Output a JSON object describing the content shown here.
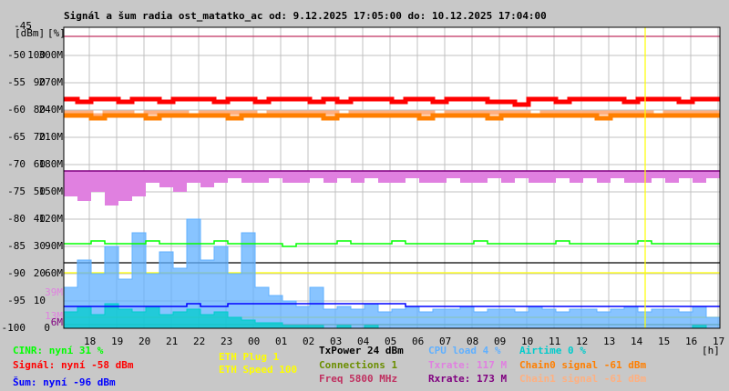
{
  "chart_data": {
    "type": "line",
    "title": "Signál a šum radia ost_matatko_ac od: 9.12.2025 17:05:00 do: 10.12.2025 17:04:00",
    "y_axis_labels": {
      "dbm_header": "[dBm]",
      "pct_header": "[%]",
      "dbm": [
        "-45",
        "-50",
        "-55",
        "-60",
        "-65",
        "-70",
        "-75",
        "-80",
        "-85",
        "-90",
        "-95",
        "-100"
      ],
      "pct": [
        "",
        "100",
        "90",
        "80",
        "70",
        "60",
        "50",
        "40",
        "30",
        "20",
        "10",
        "0"
      ],
      "rate": [
        "",
        "300M",
        "270M",
        "240M",
        "210M",
        "180M",
        "150M",
        "120M",
        "90M",
        "60M",
        "",
        ""
      ]
    },
    "ylim_dbm": [
      -100,
      -45
    ],
    "min_markers": [
      {
        "label": "39M",
        "value": 39,
        "color": "#e080e0"
      },
      {
        "label": "13M",
        "value": 13,
        "color": "#e080e0"
      },
      {
        "label": "6M",
        "value": 6,
        "color": "#800080"
      }
    ],
    "x_ticks": [
      "18",
      "19",
      "20",
      "21",
      "22",
      "23",
      "00",
      "01",
      "02",
      "03",
      "04",
      "05",
      "06",
      "07",
      "08",
      "09",
      "10",
      "11",
      "12",
      "13",
      "14",
      "15",
      "16",
      "17"
    ],
    "x_unit": "[h]",
    "x_start": "9.12.2025 17:05",
    "x_step_minutes": 30,
    "grid": true,
    "marker_time": "10.12.2025 14:20",
    "series": [
      {
        "key": "signal",
        "unit": "dBm",
        "color": "#ff0000",
        "values": [
          -58,
          -58.5,
          -58,
          -58,
          -58.5,
          -58,
          -58,
          -58.5,
          -58,
          -58,
          -58,
          -58.5,
          -58,
          -58,
          -58.5,
          -58,
          -58,
          -58,
          -58.5,
          -58,
          -58.5,
          -58,
          -58,
          -58,
          -58.5,
          -58,
          -58,
          -58.5,
          -58,
          -58,
          -58,
          -58.5,
          -58.5,
          -59,
          -58,
          -58,
          -58.5,
          -58,
          -58,
          -58,
          -58,
          -58.5,
          -58,
          -58,
          -58,
          -58.5,
          -58,
          -58
        ]
      },
      {
        "key": "chain0",
        "unit": "dBm",
        "color": "#ff7f00",
        "values": [
          -61,
          -61,
          -61.5,
          -61,
          -61,
          -61,
          -61.5,
          -61,
          -61,
          -61,
          -61,
          -61,
          -61.5,
          -61,
          -61,
          -61,
          -61,
          -61,
          -61,
          -61.5,
          -61,
          -61,
          -61,
          -61,
          -61,
          -61,
          -61.5,
          -61,
          -61,
          -61,
          -61,
          -61.5,
          -61,
          -61,
          -61,
          -61,
          -61,
          -61,
          -61,
          -61.5,
          -61,
          -61,
          -61,
          -61,
          -61,
          -61,
          -61,
          -61
        ]
      },
      {
        "key": "chain1",
        "unit": "dBm",
        "color": "#ffb080",
        "values": [
          -60.5,
          -60.5,
          -61,
          -60.5,
          -60.5,
          -61,
          -60.5,
          -60.5,
          -60.5,
          -61,
          -60.5,
          -60.5,
          -60.5,
          -60.5,
          -61,
          -60.5,
          -60.5,
          -60.5,
          -60.5,
          -60.5,
          -61,
          -60.5,
          -60.5,
          -60.5,
          -60.5,
          -60.5,
          -60.5,
          -61,
          -60.5,
          -60.5,
          -60.5,
          -60.5,
          -60.5,
          -60.5,
          -61,
          -60.5,
          -60.5,
          -60.5,
          -60.5,
          -60.5,
          -60.5,
          -60.5,
          -60.5,
          -61,
          -60.5,
          -60.5,
          -60.5,
          -60.5
        ]
      },
      {
        "key": "txrate",
        "unit": "M",
        "color": "#e080e0",
        "values": [
          145,
          140,
          150,
          135,
          140,
          145,
          160,
          155,
          150,
          160,
          155,
          160,
          165,
          160,
          160,
          165,
          160,
          160,
          165,
          160,
          165,
          160,
          165,
          160,
          160,
          165,
          160,
          160,
          165,
          160,
          160,
          165,
          160,
          165,
          160,
          160,
          165,
          160,
          165,
          160,
          165,
          160,
          160,
          165,
          160,
          165,
          160,
          165
        ]
      },
      {
        "key": "rxrate",
        "unit": "M",
        "color": "#800080",
        "values": [
          173,
          173,
          173,
          173,
          173,
          173,
          173,
          173,
          173,
          173,
          173,
          173,
          173,
          173,
          173,
          173,
          173,
          173,
          173,
          173,
          173,
          173,
          173,
          173,
          173,
          173,
          173,
          173,
          173,
          173,
          173,
          173,
          173,
          173,
          173,
          173,
          173,
          173,
          173,
          173,
          173,
          173,
          173,
          173,
          173,
          173,
          173,
          173
        ]
      },
      {
        "key": "cinr",
        "unit": "%",
        "color": "#00ff00",
        "values": [
          31,
          31,
          32,
          31,
          31,
          31,
          32,
          31,
          31,
          31,
          31,
          32,
          31,
          31,
          31,
          31,
          30,
          31,
          31,
          31,
          32,
          31,
          31,
          31,
          32,
          31,
          31,
          31,
          31,
          31,
          32,
          31,
          31,
          31,
          31,
          31,
          32,
          31,
          31,
          31,
          31,
          31,
          32,
          31,
          31,
          31,
          31,
          31
        ]
      },
      {
        "key": "noise",
        "unit": "dBm",
        "color": "#0000ff",
        "values": [
          -96,
          -96,
          -96,
          -96,
          -96,
          -96,
          -96,
          -96,
          -96,
          -95.5,
          -96,
          -96,
          -95.5,
          -95.5,
          -95.5,
          -95.5,
          -95.5,
          -95.5,
          -95.5,
          -95.5,
          -95.5,
          -95.5,
          -95.5,
          -95.5,
          -95.5,
          -96,
          -96,
          -96,
          -96,
          -96,
          -96,
          -96,
          -96,
          -96,
          -96,
          -96,
          -96,
          -96,
          -96,
          -96,
          -96,
          -96,
          -96,
          -96,
          -96,
          -96,
          -96,
          -96
        ]
      },
      {
        "key": "cpu",
        "unit": "%",
        "color": "#60b0ff",
        "values": [
          15,
          25,
          20,
          30,
          18,
          35,
          20,
          28,
          22,
          40,
          25,
          30,
          20,
          35,
          15,
          12,
          10,
          8,
          15,
          7,
          8,
          7,
          9,
          6,
          7,
          8,
          6,
          7,
          7,
          8,
          6,
          7,
          7,
          6,
          8,
          7,
          6,
          7,
          7,
          6,
          7,
          8,
          6,
          7,
          7,
          6,
          8,
          4
        ]
      },
      {
        "key": "airtime",
        "unit": "%",
        "color": "#00cccc",
        "values": [
          6,
          8,
          5,
          9,
          7,
          6,
          8,
          5,
          6,
          7,
          5,
          6,
          4,
          3,
          2,
          2,
          1,
          1,
          1,
          0,
          1,
          0,
          1,
          0,
          0,
          0,
          0,
          0,
          0,
          0,
          0,
          0,
          0,
          0,
          0,
          0,
          0,
          0,
          0,
          0,
          0,
          0,
          0,
          0,
          0,
          0,
          1,
          0
        ]
      }
    ],
    "constant_lines": [
      {
        "key": "freq",
        "color": "#c03060"
      },
      {
        "key": "txpower",
        "color": "#000000"
      },
      {
        "key": "eth_speed",
        "color": "#ffff00"
      },
      {
        "key": "eth_plug",
        "color": "#ffff00"
      },
      {
        "key": "connections",
        "color": "#6b8e00"
      }
    ]
  },
  "legend": {
    "cinr": "CINR: nyní 31 %",
    "signal": "Signál: nyní -58 dBm",
    "noise": "Šum: nyní -96 dBm",
    "eth_plug": "ETH Plug 1",
    "eth_speed": "ETH Speed 100",
    "txpower": "TxPower 24 dBm",
    "connections": "Connections 1",
    "freq": "Freq 5800 MHz",
    "cpu": "CPU load 4 %",
    "txrate": "Txrate: 117 M",
    "rxrate": "Rxrate: 173 M",
    "airtime": "Airtime 0 %",
    "chain0": "Chain0 signal -61 dBm",
    "chain1": "Chain1 signal -61 dBm"
  },
  "colors": {
    "background": "#c8c8c8",
    "plot": "#ffffff",
    "grid": "#c0c0c0"
  }
}
